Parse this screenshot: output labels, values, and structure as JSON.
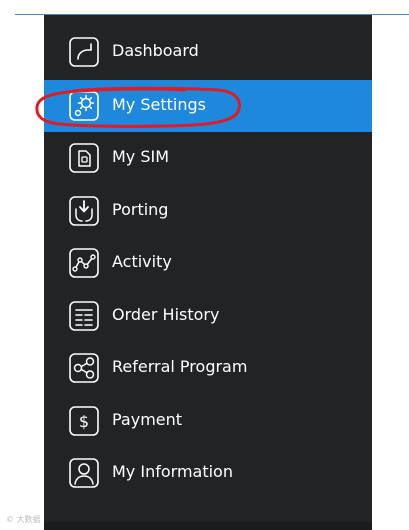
{
  "menu": {
    "items": [
      {
        "label": "Dashboard",
        "icon": "dashboard-icon"
      },
      {
        "label": "My Settings",
        "icon": "settings-icon",
        "active": true
      },
      {
        "label": "My SIM",
        "icon": "sim-icon"
      },
      {
        "label": "Porting",
        "icon": "porting-icon"
      },
      {
        "label": "Activity",
        "icon": "activity-icon"
      },
      {
        "label": "Order History",
        "icon": "order-history-icon"
      },
      {
        "label": "Referral Program",
        "icon": "referral-icon"
      },
      {
        "label": "Payment",
        "icon": "payment-icon"
      },
      {
        "label": "My Information",
        "icon": "user-icon"
      }
    ]
  },
  "annotation": {
    "color": "#e11b22",
    "target": "My Settings"
  },
  "watermark": {
    "text": "© 大数据"
  },
  "colors": {
    "sidebar_bg": "#222327",
    "active_bg": "#1e88dc",
    "text": "#ffffff",
    "top_rule": "#4f88b3"
  }
}
